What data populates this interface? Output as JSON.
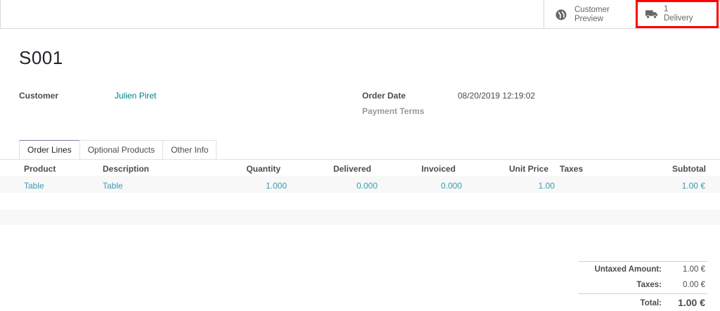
{
  "smart_buttons": {
    "customer_preview": {
      "line1": "Customer",
      "line2": "Preview",
      "icon": "globe-icon"
    },
    "delivery": {
      "line1": "1",
      "line2": "Delivery",
      "icon": "truck-icon"
    }
  },
  "order": {
    "name": "S001",
    "customer_label": "Customer",
    "customer_value": "Julien Piret",
    "order_date_label": "Order Date",
    "order_date_value": "08/20/2019 12:19:02",
    "payment_terms_label": "Payment Terms"
  },
  "tabs": [
    "Order Lines",
    "Optional Products",
    "Other Info"
  ],
  "table": {
    "headers": {
      "product": "Product",
      "description": "Description",
      "quantity": "Quantity",
      "delivered": "Delivered",
      "invoiced": "Invoiced",
      "unit_price": "Unit Price",
      "taxes": "Taxes",
      "subtotal": "Subtotal"
    },
    "rows": [
      {
        "product": "Table",
        "description": "Table",
        "quantity": "1.000",
        "delivered": "0.000",
        "invoiced": "0.000",
        "unit_price": "1.00",
        "taxes": "",
        "subtotal": "1.00 €"
      }
    ]
  },
  "totals": {
    "untaxed_label": "Untaxed Amount:",
    "untaxed_value": "1.00 €",
    "taxes_label": "Taxes:",
    "taxes_value": "0.00 €",
    "total_label": "Total:",
    "total_value": "1.00 €"
  },
  "colors": {
    "link": "#00807f",
    "row_link": "#3a9bb0",
    "highlight": "#ff0000",
    "tab_accent": "#7c7bad"
  }
}
